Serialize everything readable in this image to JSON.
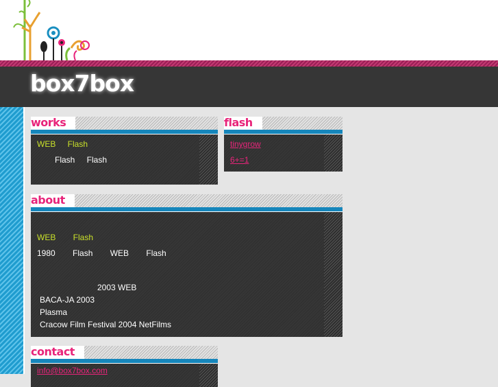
{
  "site": {
    "title": "box7box"
  },
  "works": {
    "heading": "works",
    "line1": "WEB Flash",
    "line2": "Flash Flash"
  },
  "flash": {
    "heading": "flash",
    "links": [
      "tinygrow",
      "6+=1"
    ]
  },
  "about": {
    "heading": "about",
    "line1": "WEB Flash",
    "line2": "1980 Flash WEB Flash",
    "line3": "2003 WEB",
    "line4": "BACA-JA 2003",
    "line5": "Plasma",
    "line6": "Cracow Film Festival 2004 NetFilms"
  },
  "contact": {
    "heading": "contact",
    "email": "info@box7box.com"
  },
  "colors": {
    "accent_pink": "#e8247a",
    "accent_blue": "#1686bb",
    "text_lime": "#c9e02a",
    "header_bg": "#363636"
  }
}
